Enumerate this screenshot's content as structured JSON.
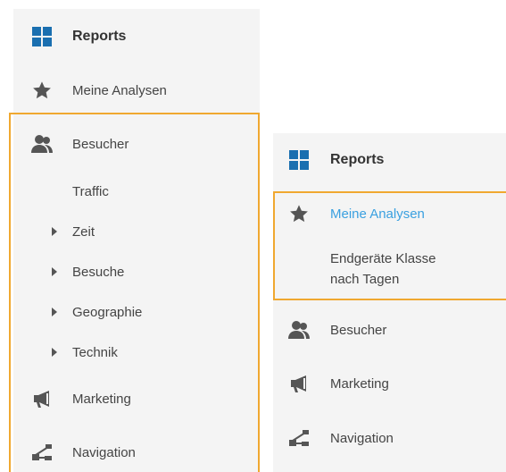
{
  "left_menu": {
    "reports": "Reports",
    "meine_analysen": "Meine Analysen",
    "besucher": "Besucher",
    "traffic": "Traffic",
    "zeit": "Zeit",
    "besuche": "Besuche",
    "geographie": "Geographie",
    "technik": "Technik",
    "marketing": "Marketing",
    "navigation": "Navigation"
  },
  "right_menu": {
    "reports": "Reports",
    "meine_analysen": "Meine Analysen",
    "endgeraete_line1": "Endgeräte Klasse",
    "endgeraete_line2": "nach Tagen",
    "besucher": "Besucher",
    "marketing": "Marketing",
    "navigation": "Navigation"
  },
  "colors": {
    "panel_bg": "#f4f4f4",
    "reports_icon": "#1a6fb0",
    "icon_gray": "#555555",
    "active_blue": "#3aa0e0",
    "highlight_orange": "#f0a830"
  },
  "icons": {
    "reports": "grid-icon",
    "meine_analysen": "star-icon",
    "besucher": "users-icon",
    "marketing": "megaphone-icon",
    "navigation": "navigation-icon",
    "expand": "caret-right-icon"
  }
}
